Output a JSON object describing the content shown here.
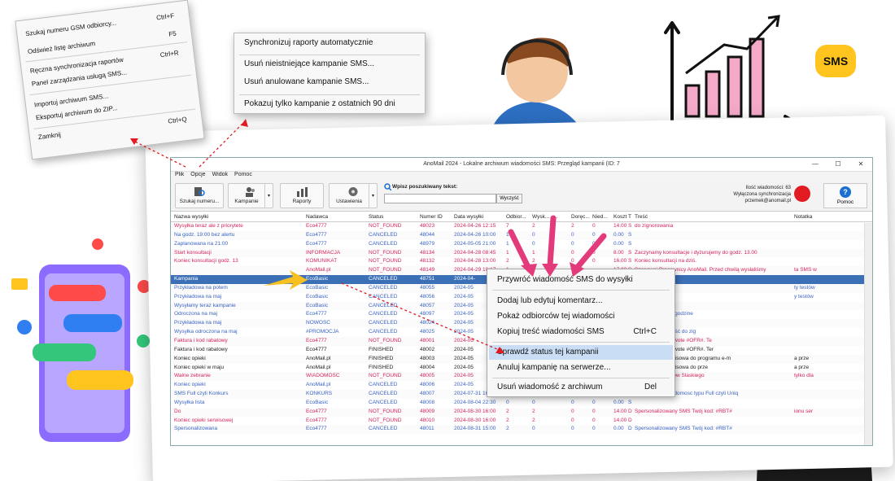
{
  "window": {
    "title": "AnoMail 2024 - Lokalne archiwum wiadomości SMS: Przegląd kampanii (ID: 7",
    "controls": [
      "—",
      "☐",
      "✕"
    ]
  },
  "menubar": [
    "Plik",
    "Opcje",
    "Widok",
    "Pomoc"
  ],
  "toolbar": {
    "search_number": "Szukaj numeru...",
    "campaigns": "Kampanie",
    "reports": "Raporty",
    "settings": "Ustawienia",
    "search_label": "Wpisz poszukiwany tekst:",
    "search_value": "",
    "search_button": "Wyczyść",
    "info_line1": "Ilość wiadomości: 63",
    "info_line2": "Wyłączona synchronizacja",
    "info_line3": "przemek@anomail.pl",
    "help": "Pomoc"
  },
  "columns": [
    "Nazwa wysyłki",
    "Nadawca",
    "Status",
    "Numer ID",
    "Data wysyłki",
    "Odbior...",
    "Wysk...",
    "...",
    "Doręc...",
    "Nied...",
    "Koszt",
    "T",
    "Treść",
    "Notatka"
  ],
  "rows": [
    {
      "name": "Wysyłka teraz ale z priorytete",
      "sender": "Eco4777",
      "status": "NOT_FOUND",
      "id": "48023",
      "date": "2024-04-26 12:15",
      "n1": "7",
      "n2": "2",
      "n3": "",
      "n4": "2",
      "n5": "0",
      "cost": "14.00",
      "t": "S",
      "text": "do zignorowania",
      "note": "",
      "color": "#d6245a"
    },
    {
      "name": "Na godz. 19:00 bez alertu",
      "sender": "Eco4777",
      "status": "CANCELED",
      "id": "48044",
      "date": "2024-04-26 10:00",
      "n1": "1",
      "n2": "0",
      "n3": "",
      "n4": "0",
      "n5": "0",
      "cost": "0.00",
      "t": "S",
      "text": "",
      "note": "",
      "color": "#3a63c4"
    },
    {
      "name": "Zaplanowana na 21:00",
      "sender": "Eco4777",
      "status": "CANCELED",
      "id": "48979",
      "date": "2024-05-05 21:00",
      "n1": "1",
      "n2": "0",
      "n3": "",
      "n4": "0",
      "n5": "0",
      "cost": "0.00",
      "t": "S",
      "text": "",
      "note": "",
      "color": "#3a63c4"
    },
    {
      "name": "Start konsultacji",
      "sender": "INFORMACJA",
      "status": "NOT_FOUND",
      "id": "48134",
      "date": "2024-04-28 08:45",
      "n1": "1",
      "n2": "1",
      "n3": "",
      "n4": "0",
      "n5": "0",
      "cost": "8.00",
      "t": "S",
      "text": "Zaczynamy konsultacje i dyżurujemy do godz. 13.00",
      "note": "",
      "color": "#d6245a"
    },
    {
      "name": "Koniec konsultacji godz. 13",
      "sender": "KOMUNIKAT",
      "status": "NOT_FOUND",
      "id": "48132",
      "date": "2024-04-28 13:00",
      "n1": "2",
      "n2": "2",
      "n3": "",
      "n4": "0",
      "n5": "0",
      "cost": "16.00",
      "t": "S",
      "text": "Koniec konsultacji na dziś.",
      "note": "",
      "color": "#d6245a"
    },
    {
      "name": "",
      "sender": "AnoMail.pl",
      "status": "NOT_FOUND",
      "id": "48149",
      "date": "2024-04-29 10:17",
      "n1": "1",
      "n2": "",
      "n3": "",
      "n4": "",
      "n5": "",
      "cost": "17.00",
      "t": "S",
      "text": "Szanowni Pracownicy AnoMail. Przed chwilą wysłaliśmy",
      "note": "ta SMS w",
      "color": "#d6245a"
    },
    {
      "name": "Kampania",
      "sender": "EcoBasic",
      "status": "CANCELED",
      "id": "48751",
      "date": "2024-04-",
      "n1": "",
      "n2": "",
      "n3": "",
      "n4": "",
      "n5": "",
      "cost": "",
      "t": "",
      "text": "",
      "note": "",
      "color": "#fff",
      "sel": true
    },
    {
      "name": "Przykładowa na potem",
      "sender": "EcoBasic",
      "status": "CANCELED",
      "id": "48055",
      "date": "2024-05",
      "n1": "",
      "n2": "",
      "n3": "",
      "n4": "",
      "n5": "",
      "cost": "",
      "t": "",
      "text": "Przykładowa",
      "note": "ty testów",
      "color": "#3a63c4"
    },
    {
      "name": "Przykładowa na maj",
      "sender": "EcoBasic",
      "status": "CANCELED",
      "id": "48056",
      "date": "2024-05",
      "n1": "",
      "n2": "",
      "n3": "",
      "n4": "",
      "n5": "",
      "cost": "",
      "t": "",
      "text": "Przykładowa",
      "note": "y testów",
      "color": "#3a63c4"
    },
    {
      "name": "Wysyłamy teraz kampanie",
      "sender": "EcoBasic",
      "status": "CANCELED",
      "id": "48057",
      "date": "2024-05",
      "n1": "",
      "n2": "",
      "n3": "",
      "n4": "",
      "n5": "",
      "cost": "",
      "t": "",
      "text": "",
      "note": "",
      "color": "#3a63c4"
    },
    {
      "name": "Odroczona na maj",
      "sender": "Eco4777",
      "status": "CANCELED",
      "id": "48097",
      "date": "2024-05",
      "n1": "",
      "n2": "",
      "n3": "",
      "n4": "",
      "n5": "",
      "cost": "",
      "t": "",
      "text": "zignorowania na godzine",
      "note": "",
      "color": "#3a63c4"
    },
    {
      "name": "Przykładowa na maj",
      "sender": "NOWOSC",
      "status": "CANCELED",
      "id": "48024",
      "date": "2024-05",
      "n1": "",
      "n2": "",
      "n3": "",
      "n4": "",
      "n5": "",
      "cost": "",
      "t": "",
      "text": "do zignorowania",
      "note": "",
      "color": "#3a63c4"
    },
    {
      "name": "Wysyłka odroczona na maj",
      "sender": "#PROMOCJA",
      "status": "CANCELED",
      "id": "48025",
      "date": "2024-05",
      "n1": "",
      "n2": "",
      "n3": "",
      "n4": "",
      "n5": "",
      "cost": "",
      "t": "",
      "text": "102222 wiadomość do zig",
      "note": "",
      "color": "#3a63c4"
    },
    {
      "name": "Faktura i kod rabatowy",
      "sender": "Eco4777",
      "status": "NOT_FOUND",
      "id": "48001",
      "date": "2024-05",
      "n1": "",
      "n2": "",
      "n3": "",
      "n4": "",
      "n5": "",
      "cost": "",
      "t": "",
      "text": "kture #INF# na kwote #OFR#. Te",
      "note": "",
      "color": "#d6245a"
    },
    {
      "name": "Faktura i kod rabatowy",
      "sender": "Eco4777",
      "status": "FINISHED",
      "id": "48002",
      "date": "2024-05",
      "n1": "",
      "n2": "",
      "n3": "",
      "n4": "",
      "n5": "",
      "cost": "",
      "t": "",
      "text": "kture #INF# na kwote #OFR#. Ter",
      "note": "",
      "color": "#222"
    },
    {
      "name": "Koniec opieki",
      "sender": "AnoMail.pl",
      "status": "FINISHED",
      "id": "48003",
      "date": "2024-05",
      "n1": "",
      "n2": "",
      "n3": "",
      "n4": "",
      "n5": "",
      "cost": "",
      "t": "",
      "text": "stwu opieka serwisowa do programu e-m",
      "note": "a prze",
      "color": "#222"
    },
    {
      "name": "Koniec opieki w maju",
      "sender": "AnoMail.pl",
      "status": "FINISHED",
      "id": "48004",
      "date": "2024-05",
      "n1": "",
      "n2": "",
      "n3": "",
      "n4": "",
      "n5": "",
      "cost": "",
      "t": "",
      "text": "stwu opieka serwisowa do prze",
      "note": "a prze",
      "color": "#222"
    },
    {
      "name": "Walne zebranie",
      "sender": "WIADOMOSC",
      "status": "NOT_FOUND",
      "id": "48005",
      "date": "2024-05",
      "n1": "",
      "n2": "",
      "n3": "",
      "n4": "",
      "n5": "",
      "cost": "",
      "t": "",
      "text": "Zebranie Członków Slaskiego",
      "note": "tylko dla",
      "color": "#d6245a"
    },
    {
      "name": "Koniec opieki",
      "sender": "AnoMail.pl",
      "status": "CANCELED",
      "id": "48006",
      "date": "2024-05",
      "n1": "",
      "n2": "",
      "n3": "",
      "n4": "",
      "n5": "",
      "cost": "",
      "t": "",
      "text": "do zignorowania",
      "note": "",
      "color": "#3a63c4"
    },
    {
      "name": "SMS Full czyli Konkurs",
      "sender": "KONKURS",
      "status": "CANCELED",
      "id": "48007",
      "date": "2024-07-31 16:00",
      "n1": "2",
      "n2": "0",
      "n3": "",
      "n4": "0",
      "n5": "0",
      "cost": "0.00",
      "t": "S",
      "text": "Przykładowa wiadomosc typu Full czyli Uniq",
      "note": "",
      "color": "#3a63c4"
    },
    {
      "name": "Wysyłka lista",
      "sender": "EcoBasic",
      "status": "CANCELED",
      "id": "48008",
      "date": "2024-08-04 22:30",
      "n1": "0",
      "n2": "0",
      "n3": "",
      "n4": "0",
      "n5": "0",
      "cost": "0.00",
      "t": "S",
      "text": "",
      "note": "",
      "color": "#3a63c4"
    },
    {
      "name": "Do",
      "sender": "Eco4777",
      "status": "NOT_FOUND",
      "id": "48009",
      "date": "2024-08-30 16:00",
      "n1": "2",
      "n2": "2",
      "n3": "",
      "n4": "0",
      "n5": "0",
      "cost": "14.00",
      "t": "D",
      "text": "Spersonalizowany SMS Twój kod: #RBT#",
      "note": "ionu ser",
      "color": "#d6245a"
    },
    {
      "name": "Koniec opieki serwisowej",
      "sender": "Eco4777",
      "status": "NOT_FOUND",
      "id": "48010",
      "date": "2024-08-30 16:00",
      "n1": "2",
      "n2": "2",
      "n3": "",
      "n4": "0",
      "n5": "0",
      "cost": "14.00",
      "t": "D",
      "text": "",
      "note": "",
      "color": "#d6245a"
    },
    {
      "name": "Spersonalizowana",
      "sender": "Eco4777",
      "status": "CANCELED",
      "id": "48011",
      "date": "2024-08-31 15:00",
      "n1": "2",
      "n2": "0",
      "n3": "",
      "n4": "0",
      "n5": "0",
      "cost": "0.00",
      "t": "D",
      "text": "Spersonalizowany SMS Twój kod: #RBT#",
      "note": "",
      "color": "#3a63c4"
    }
  ],
  "context_menu": {
    "items": [
      {
        "label": "Przywróć wiadomość SMS do wysyłki",
        "shortcut": ""
      },
      {
        "label": "Dodaj lub edytuj komentarz...",
        "shortcut": ""
      },
      {
        "label": "Pokaż odbiorców tej wiadomości",
        "shortcut": ""
      },
      {
        "label": "Kopiuj treść wiadomości SMS",
        "shortcut": "Ctrl+C"
      },
      {
        "label": "Sprawdź status tej kampanii",
        "shortcut": ""
      },
      {
        "label": "Anuluj kampanię na serwerze...",
        "shortcut": ""
      },
      {
        "label": "Usuń wiadomość z archiwum",
        "shortcut": "Del"
      }
    ],
    "highlighted": "Sprawdź status tej kampanii"
  },
  "file_menu": {
    "items": [
      {
        "label": "Szukaj numeru GSM odbiorcy...",
        "shortcut": "Ctrl+F"
      },
      {
        "label": "Odśwież listę archiwum",
        "shortcut": "F5"
      },
      {
        "label": "Ręczna synchronizacja raportów",
        "shortcut": "Ctrl+R"
      },
      {
        "label": "Panel zarządzania usługą SMS...",
        "shortcut": ""
      },
      {
        "label": "Importuj archiwum SMS...",
        "shortcut": ""
      },
      {
        "label": "Eksportuj archiwum do ZIP...",
        "shortcut": ""
      },
      {
        "label": "Zamknij",
        "shortcut": "Ctrl+Q"
      }
    ]
  },
  "options_menu": {
    "items": [
      "Synchronizuj raporty automatycznie",
      "Usuń nieistniejące kampanie SMS...",
      "Usuń anulowane kampanie SMS...",
      "Pokazuj tylko kampanie z ostatnich 90 dni"
    ]
  },
  "badge": "SMS",
  "colors": {
    "pink": "#e23a7a",
    "selection": "#3b6fb6",
    "menu_highlight": "#c9def5",
    "yellow": "#ffc51e"
  }
}
